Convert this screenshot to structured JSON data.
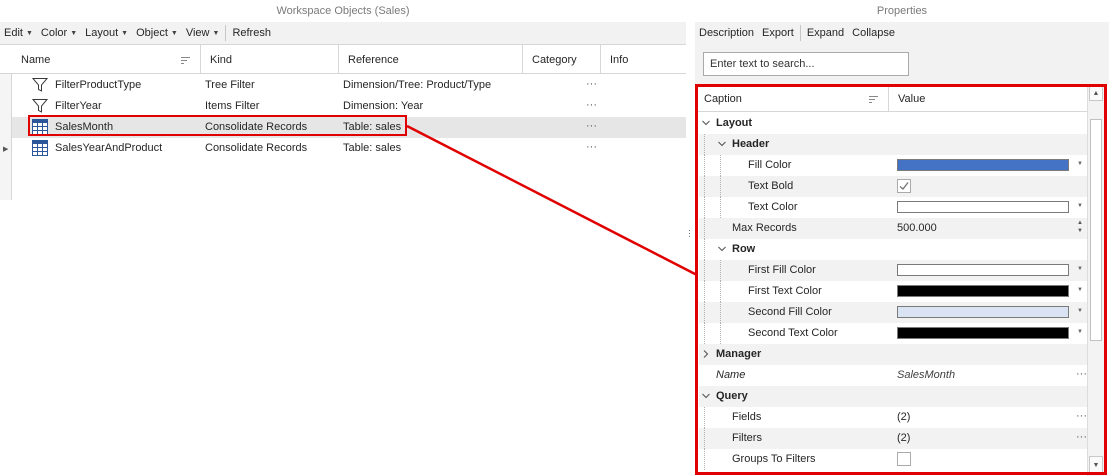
{
  "left_pane": {
    "title": "Workspace Objects (Sales)",
    "menu": [
      {
        "label": "Edit",
        "has_dropdown": true
      },
      {
        "label": "Color",
        "has_dropdown": true
      },
      {
        "label": "Layout",
        "has_dropdown": true
      },
      {
        "label": "Object",
        "has_dropdown": true
      },
      {
        "label": "View",
        "has_dropdown": true
      },
      {
        "label": "Refresh",
        "has_dropdown": false
      }
    ],
    "columns": [
      "Name",
      "Kind",
      "Reference",
      "Category",
      "Info"
    ],
    "rows": [
      {
        "icon": "funnel-icon",
        "name": "FilterProductType",
        "kind": "Tree Filter",
        "reference": "Dimension/Tree: Product/Type",
        "category": "···",
        "selected": false
      },
      {
        "icon": "funnel-icon",
        "name": "FilterYear",
        "kind": "Items Filter",
        "reference": "Dimension: Year",
        "category": "···",
        "selected": false
      },
      {
        "icon": "table-icon",
        "name": "SalesMonth",
        "kind": "Consolidate Records",
        "reference": "Table: sales",
        "category": "···",
        "selected": true
      },
      {
        "icon": "table-icon",
        "name": "SalesYearAndProduct",
        "kind": "Consolidate Records",
        "reference": "Table: sales",
        "category": "···",
        "selected": false
      }
    ]
  },
  "right_pane": {
    "title": "Properties",
    "toolbar": [
      {
        "label": "Description"
      },
      {
        "label": "Export"
      },
      {
        "label": "Expand"
      },
      {
        "label": "Collapse"
      }
    ],
    "search": {
      "placeholder": "Enter text to search..."
    },
    "columns": {
      "caption": "Caption",
      "value": "Value"
    },
    "properties": [
      {
        "caption": "Layout",
        "level": 0,
        "type": "group",
        "expanded": true
      },
      {
        "caption": "Header",
        "level": 1,
        "type": "group",
        "expanded": true
      },
      {
        "caption": "Fill Color",
        "level": 2,
        "type": "color",
        "color": "#4472c4"
      },
      {
        "caption": "Text Bold",
        "level": 2,
        "type": "checkbox",
        "checked": true
      },
      {
        "caption": "Text Color",
        "level": 2,
        "type": "color",
        "color": "#ffffff"
      },
      {
        "caption": "Max Records",
        "level": 1,
        "type": "spin",
        "value": "500.000"
      },
      {
        "caption": "Row",
        "level": 1,
        "type": "group",
        "expanded": true
      },
      {
        "caption": "First Fill Color",
        "level": 2,
        "type": "color",
        "color": "#ffffff"
      },
      {
        "caption": "First Text Color",
        "level": 2,
        "type": "color",
        "color": "#000000"
      },
      {
        "caption": "Second Fill Color",
        "level": 2,
        "type": "color",
        "color": "#dae3f3"
      },
      {
        "caption": "Second Text Color",
        "level": 2,
        "type": "color",
        "color": "#000000"
      },
      {
        "caption": "Manager",
        "level": 0,
        "type": "group",
        "expanded": false
      },
      {
        "caption": "Name",
        "level": 0,
        "type": "text",
        "value": "SalesMonth",
        "italic": true,
        "ellipsis": "···"
      },
      {
        "caption": "Query",
        "level": 0,
        "type": "group",
        "expanded": true
      },
      {
        "caption": "Fields",
        "level": 1,
        "type": "text",
        "value": "(2)",
        "ellipsis": "···"
      },
      {
        "caption": "Filters",
        "level": 1,
        "type": "text",
        "value": "(2)",
        "ellipsis": "···"
      },
      {
        "caption": "Groups To Filters",
        "level": 1,
        "type": "checkbox",
        "checked": false
      }
    ]
  },
  "colors": {
    "highlight": "#e00000",
    "selected_row": "#e6e6e6",
    "toolbar_bg": "#f2f2f2"
  }
}
